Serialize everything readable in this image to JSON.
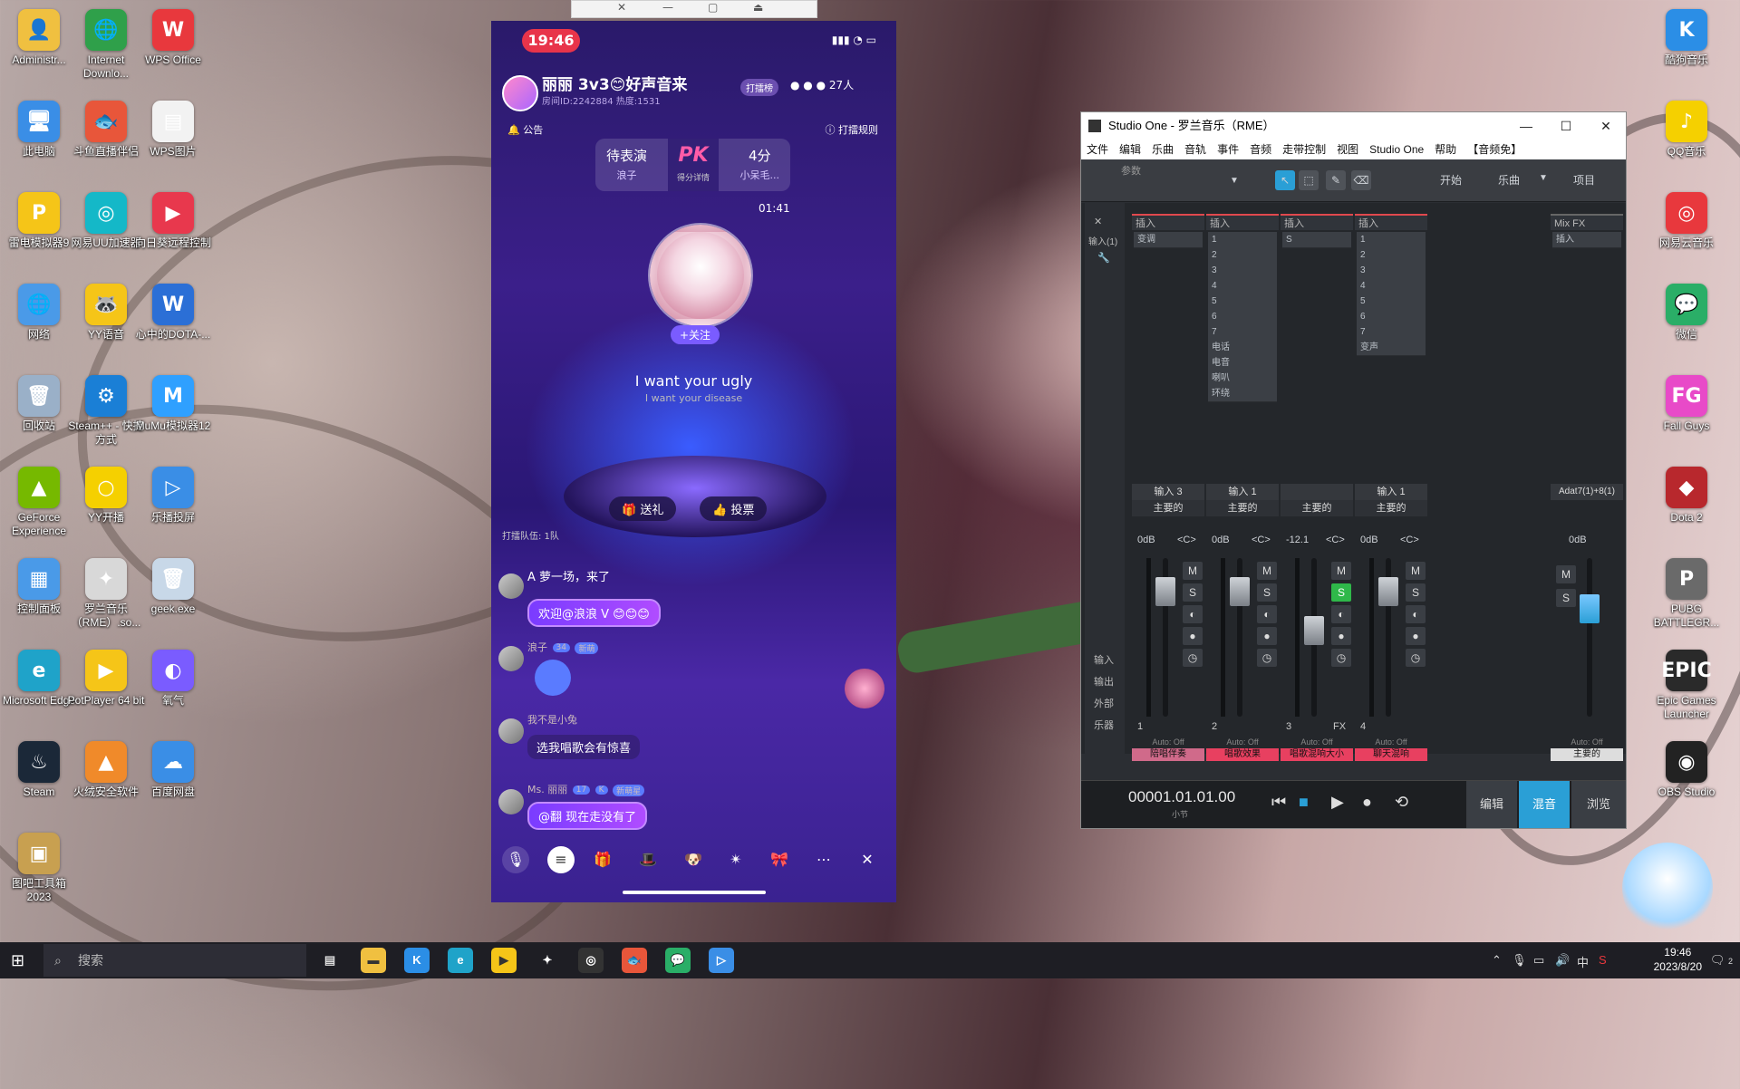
{
  "desktop_left": [
    {
      "label": "Administr...",
      "glyph": "👤",
      "color": "#f0c040"
    },
    {
      "label": "Internet Downlo...",
      "glyph": "🌐",
      "color": "#2fa04a"
    },
    {
      "label": "WPS Office",
      "glyph": "W",
      "color": "#e8383d"
    },
    {
      "label": "此电脑",
      "glyph": "🖥",
      "color": "#3a8ee6"
    },
    {
      "label": "斗鱼直播伴侣",
      "glyph": "🐟",
      "color": "#e8563a"
    },
    {
      "label": "WPS图片",
      "glyph": "▤",
      "color": "#f2f2f2"
    },
    {
      "label": "雷电模拟器9",
      "glyph": "P",
      "color": "#f5c518"
    },
    {
      "label": "网易UU加速器",
      "glyph": "◎",
      "color": "#14b8c8"
    },
    {
      "label": "向日葵远程控制",
      "glyph": "▶",
      "color": "#e8384d"
    },
    {
      "label": "网络",
      "glyph": "🌐",
      "color": "#4a9ae8"
    },
    {
      "label": "YY语音",
      "glyph": "🦝",
      "color": "#f5c518"
    },
    {
      "label": "心中的DOTA-...",
      "glyph": "W",
      "color": "#2b6fd6"
    },
    {
      "label": "回收站",
      "glyph": "🗑",
      "color": "#9ab0c8"
    },
    {
      "label": "Steam++ - 快捷方式",
      "glyph": "⚙",
      "color": "#1a7fd6"
    },
    {
      "label": "MuMu模拟器12",
      "glyph": "M",
      "color": "#2fa0ff"
    },
    {
      "label": "GeForce Experience",
      "glyph": "▲",
      "color": "#76b900"
    },
    {
      "label": "YY开播",
      "glyph": "○",
      "color": "#f5d000"
    },
    {
      "label": "乐播投屏",
      "glyph": "▷",
      "color": "#3a8ee6"
    },
    {
      "label": "控制面板",
      "glyph": "▦",
      "color": "#4a9ae8"
    },
    {
      "label": "罗兰音乐（RME）.so...",
      "glyph": "✦",
      "color": "#d8d8d8"
    },
    {
      "label": "geek.exe",
      "glyph": "🗑",
      "color": "#c8d8e8"
    },
    {
      "label": "Microsoft Edge",
      "glyph": "e",
      "color": "#1fa3c9"
    },
    {
      "label": "PotPlayer 64 bit",
      "glyph": "▶",
      "color": "#f5c518"
    },
    {
      "label": "氧气",
      "glyph": "◐",
      "color": "#7a5cff"
    },
    {
      "label": "Steam",
      "glyph": "♨",
      "color": "#1b2838"
    },
    {
      "label": "火绒安全软件",
      "glyph": "▲",
      "color": "#f08a2a"
    },
    {
      "label": "百度网盘",
      "glyph": "☁",
      "color": "#3a8ee6"
    },
    {
      "label": "图吧工具箱2023",
      "glyph": "▣",
      "color": "#c8a050"
    }
  ],
  "desktop_right": [
    {
      "label": "酷狗音乐",
      "glyph": "K",
      "color": "#2b8ee6"
    },
    {
      "label": "QQ音乐",
      "glyph": "♪",
      "color": "#f5d000"
    },
    {
      "label": "网易云音乐",
      "glyph": "◎",
      "color": "#e8383d"
    },
    {
      "label": "微信",
      "glyph": "💬",
      "color": "#2aae67"
    },
    {
      "label": "Fall Guys",
      "glyph": "FG",
      "color": "#e84ac8"
    },
    {
      "label": "Dota 2",
      "glyph": "◆",
      "color": "#b8282d"
    },
    {
      "label": "PUBG BATTLEGR...",
      "glyph": "P",
      "color": "#6a6a6a"
    },
    {
      "label": "Epic Games Launcher",
      "glyph": "EPIC",
      "color": "#2a2a2a"
    },
    {
      "label": "OBS Studio",
      "glyph": "◉",
      "color": "#222"
    }
  ],
  "phone": {
    "time": "19:46",
    "room_title": "丽丽 3v3😊好声音来",
    "room_sub": "房间ID:2242884  热度:1531",
    "rank_label": "打擂榜",
    "online": "27人",
    "notice": "公告",
    "rule": "打擂规则",
    "pk_left": "待表演",
    "pk_left_sub": "浪子",
    "pk_mid": "PK",
    "pk_mid_sub": "得分详情",
    "pk_right": "4分",
    "pk_right_sub": "小呆毛...",
    "countdown": "01:41",
    "follow": "+关注",
    "lyric1": "I want your ugly",
    "lyric2": "I want your disease",
    "gift": "送礼",
    "vote": "投票",
    "queue": "打擂队伍: 1队",
    "chat": [
      {
        "user": "A  萝一场，来了",
        "text": ""
      },
      {
        "user": "",
        "text": "欢迎@浪浪 V 😊😊😊"
      },
      {
        "user": "浪子",
        "text": ""
      },
      {
        "user": "我不是小兔",
        "text": "选我唱歌会有惊喜"
      },
      {
        "user": "Ms. 丽丽",
        "text": "@翻 现在走没有了"
      }
    ],
    "badges": [
      "K",
      "新萌星",
      "34",
      "新萌",
      "17"
    ]
  },
  "studio": {
    "title": "Studio One - 罗兰音乐（RME）",
    "menu": [
      "文件",
      "编辑",
      "乐曲",
      "音轨",
      "事件",
      "音频",
      "走带控制",
      "视图",
      "Studio One",
      "帮助",
      "【音频免】"
    ],
    "param_label": "参数",
    "toolbar_right": [
      "开始",
      "乐曲",
      "项目"
    ],
    "side_labels": [
      "输入",
      "输出",
      "外部",
      "乐器"
    ],
    "in_label": "输入(1)",
    "channels": [
      {
        "head": "插入",
        "slots": [
          "变调"
        ],
        "input": "输入 3",
        "output": "主要的",
        "vol": "0dB",
        "pan": "<C>",
        "num": "1",
        "auto": "Auto: Off",
        "name": "陪唱伴奏",
        "name_color": "#d06a8a",
        "fader_frac": 0.15
      },
      {
        "head": "插入",
        "slots": [
          "1",
          "2",
          "3",
          "4",
          "5",
          "6",
          "7",
          "电话",
          "电音",
          "喇叭",
          "环绕"
        ],
        "input": "输入 1",
        "output": "主要的",
        "vol": "0dB",
        "pan": "<C>",
        "num": "2",
        "auto": "Auto: Off",
        "name": "唱歌效果",
        "name_color": "#e84060",
        "fader_frac": 0.15
      },
      {
        "head": "插入",
        "slots": [
          "S"
        ],
        "input": "",
        "output": "主要的",
        "vol": "-12.1",
        "pan": "<C>",
        "num": "3",
        "auto": "Auto: Off",
        "name": "唱歌混响大小",
        "name_color": "#e84060",
        "fader_frac": 0.45
      },
      {
        "head": "插入",
        "slots": [
          "1",
          "2",
          "3",
          "4",
          "5",
          "6",
          "7",
          "变声"
        ],
        "input": "输入 1",
        "output": "主要的",
        "vol": "0dB",
        "pan": "<C>",
        "num": "4",
        "auto": "Auto: Off",
        "name": "聊天混响",
        "name_color": "#e84060",
        "fader_frac": 0.15
      }
    ],
    "mixfx": {
      "head": "Mix FX",
      "slot": "插入",
      "device": "Adat7(1)+8(1)",
      "vol": "0dB",
      "auto": "Auto: Off",
      "output": "主要的"
    },
    "fx_label": "FX",
    "time": "00001.01.01.00",
    "time_sub": "小节",
    "views": [
      "编辑",
      "混音",
      "浏览"
    ],
    "active_view": "混音"
  },
  "taskbar": {
    "search_placeholder": "搜索",
    "clock_time": "19:46",
    "clock_date": "2023/8/20",
    "ime": "中",
    "notif_count": "2"
  }
}
